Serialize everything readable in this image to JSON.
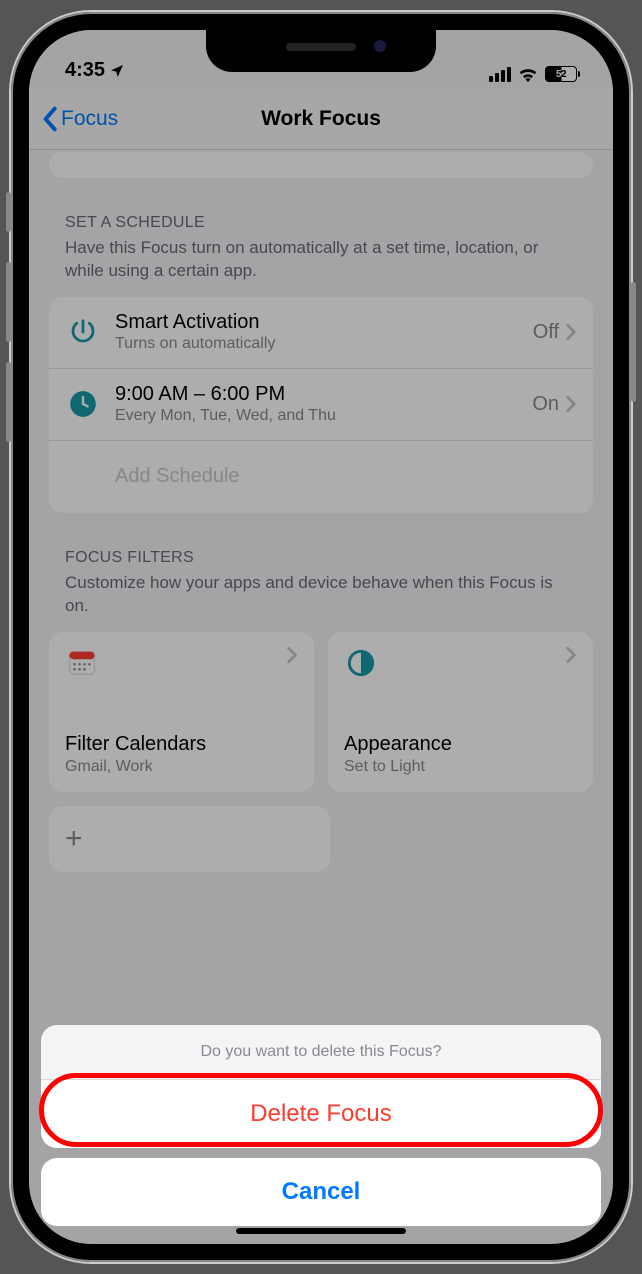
{
  "status": {
    "time": "4:35",
    "battery": "52"
  },
  "nav": {
    "back": "Focus",
    "title": "Work Focus"
  },
  "schedule": {
    "header": "SET A SCHEDULE",
    "desc": "Have this Focus turn on automatically at a set time, location, or while using a certain app.",
    "rows": [
      {
        "title": "Smart Activation",
        "sub": "Turns on automatically",
        "value": "Off"
      },
      {
        "title": "9:00 AM – 6:00 PM",
        "sub": "Every Mon, Tue, Wed, and Thu",
        "value": "On"
      }
    ],
    "add": "Add Schedule"
  },
  "filters": {
    "header": "FOCUS FILTERS",
    "desc": "Customize how your apps and device behave when this Focus is on.",
    "cards": [
      {
        "title": "Filter Calendars",
        "sub": "Gmail, Work"
      },
      {
        "title": "Appearance",
        "sub": "Set to Light"
      }
    ]
  },
  "sheet": {
    "message": "Do you want to delete this Focus?",
    "delete": "Delete Focus",
    "cancel": "Cancel"
  }
}
